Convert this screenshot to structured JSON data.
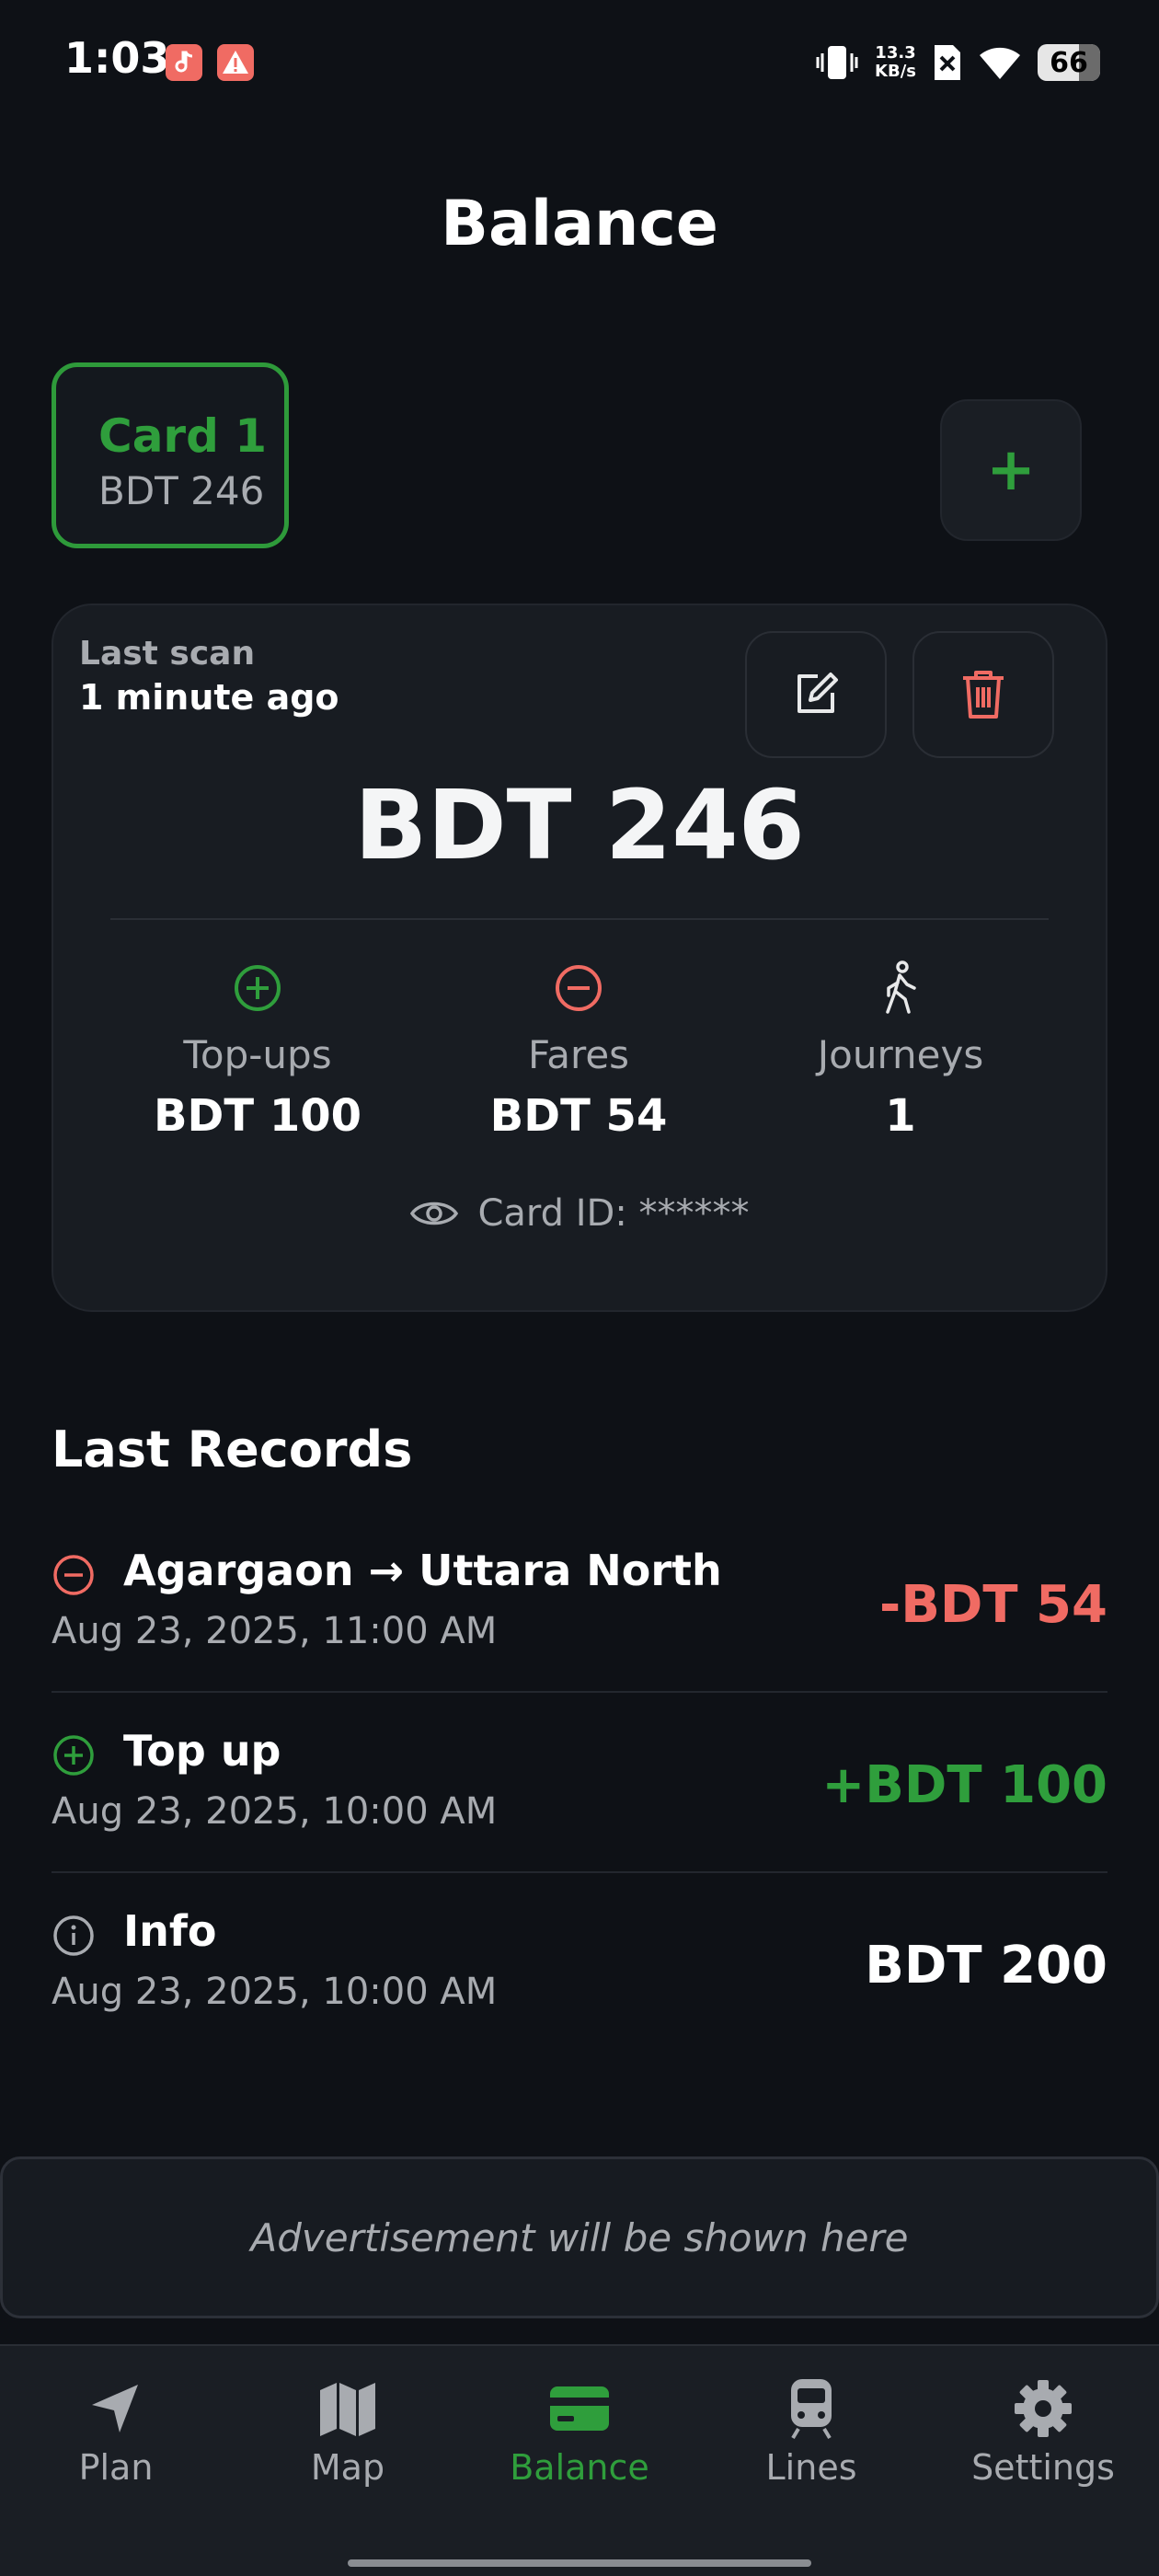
{
  "status_bar": {
    "time": "1:03",
    "net_speed_value": "13.3",
    "net_speed_unit": "KB/s",
    "battery": "66",
    "battery_level_percent": 66,
    "icons": [
      "music-app-icon",
      "warning-app-icon",
      "vibrate-icon",
      "no-sim-icon",
      "wifi-icon",
      "battery-icon"
    ]
  },
  "header": {
    "title": "Balance"
  },
  "cards": [
    {
      "name": "Card 1",
      "balance": "BDT 246",
      "selected": true
    }
  ],
  "add_card_label": "+",
  "balance_card": {
    "last_scan_label": "Last scan",
    "last_scan_value": "1 minute ago",
    "balance": "BDT 246",
    "stats": {
      "topups": {
        "label": "Top-ups",
        "value": "BDT 100"
      },
      "fares": {
        "label": "Fares",
        "value": "BDT 54"
      },
      "journeys": {
        "label": "Journeys",
        "value": "1"
      }
    },
    "card_id": "Card ID: ******"
  },
  "records": {
    "title": "Last Records",
    "items": [
      {
        "type": "fare",
        "icon": "minus-circle-icon",
        "title": "Agargaon → Uttara North",
        "date": "Aug 23, 2025, 11:00 AM",
        "amount": "-BDT 54"
      },
      {
        "type": "topup",
        "icon": "plus-circle-icon",
        "title": "Top up",
        "date": "Aug 23, 2025, 10:00 AM",
        "amount": "+BDT 100"
      },
      {
        "type": "info",
        "icon": "info-circle-icon",
        "title": "Info",
        "date": "Aug 23, 2025, 10:00 AM",
        "amount": "BDT 200"
      }
    ]
  },
  "ad": {
    "text": "Advertisement will be shown here"
  },
  "nav": {
    "items": [
      {
        "label": "Plan",
        "icon": "navigation-arrow-icon"
      },
      {
        "label": "Map",
        "icon": "map-icon"
      },
      {
        "label": "Balance",
        "icon": "card-icon",
        "active": true
      },
      {
        "label": "Lines",
        "icon": "train-icon"
      },
      {
        "label": "Settings",
        "icon": "gear-icon"
      }
    ]
  },
  "colors": {
    "background": "#0e1116",
    "surface": "#181c22",
    "accent_green": "#2f9e3c",
    "negative_red": "#f06b63",
    "muted_text": "#a8abb0"
  }
}
